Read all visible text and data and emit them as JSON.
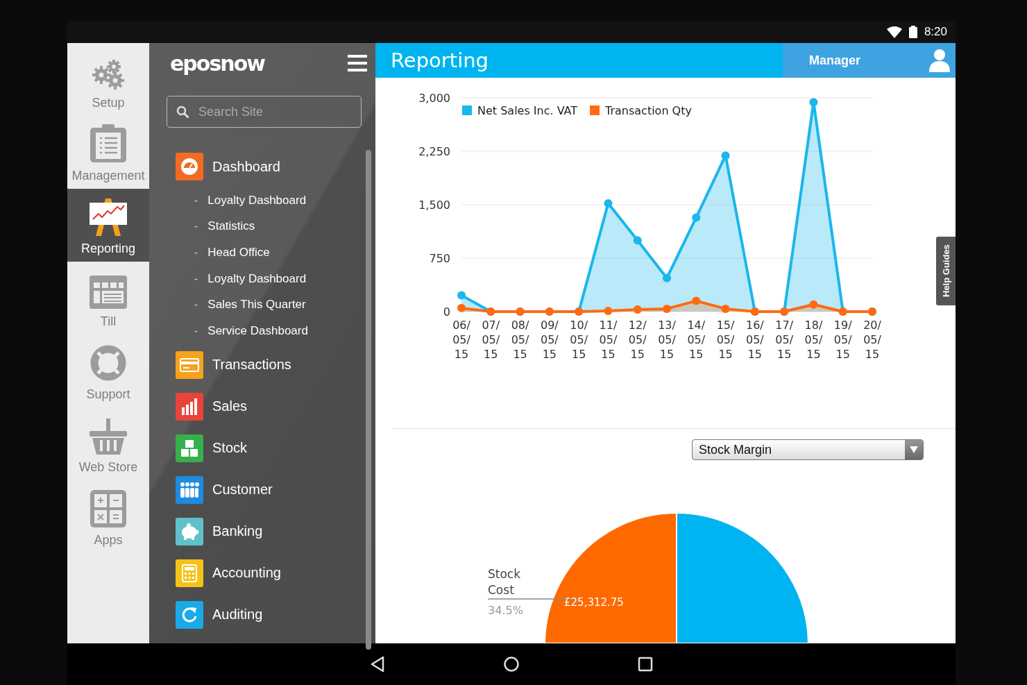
{
  "status_bar": {
    "time": "8:20"
  },
  "rail": {
    "items": [
      {
        "label": "Setup",
        "selected": false
      },
      {
        "label": "Management",
        "selected": false
      },
      {
        "label": "Reporting",
        "selected": true
      },
      {
        "label": "Till",
        "selected": false
      },
      {
        "label": "Support",
        "selected": false
      },
      {
        "label": "Web Store",
        "selected": false
      },
      {
        "label": "Apps",
        "selected": false
      }
    ]
  },
  "menu": {
    "logo": "eposnow",
    "search": {
      "placeholder": "Search Site"
    },
    "items": [
      {
        "label": "Dashboard",
        "color": "#f26b21",
        "children": [
          {
            "marker": "-",
            "label": "Loyalty Dashboard"
          },
          {
            "marker": "-",
            "label": "Statistics"
          },
          {
            "marker": "-",
            "label": "Head Office"
          },
          {
            "marker": "-",
            "label": "Loyalty Dashboard"
          },
          {
            "marker": "-",
            "label": "Sales This Quarter"
          },
          {
            "marker": "-",
            "label": "Service Dashboard"
          }
        ]
      },
      {
        "label": "Transactions",
        "color": "#f6a21d"
      },
      {
        "label": "Sales",
        "color": "#e8443a"
      },
      {
        "label": "Stock",
        "color": "#35b04a"
      },
      {
        "label": "Customer",
        "color": "#1e8be0"
      },
      {
        "label": "Banking",
        "color": "#5fc1c9"
      },
      {
        "label": "Accounting",
        "color": "#f5c316"
      },
      {
        "label": "Auditing",
        "color": "#1aaae8"
      }
    ]
  },
  "header": {
    "title": "Reporting",
    "user": "Manager"
  },
  "sales_chart": {
    "chart_data": {
      "type": "area",
      "categories": [
        "06/05/15",
        "07/05/15",
        "08/05/15",
        "09/05/15",
        "10/05/15",
        "11/05/15",
        "12/05/15",
        "13/05/15",
        "14/05/15",
        "15/05/15",
        "16/05/15",
        "17/05/15",
        "18/05/15",
        "19/05/15",
        "20/05/15"
      ],
      "series": [
        {
          "name": "Net Sales Inc. VAT",
          "color": "#1ab6ec",
          "values": [
            230,
            0,
            0,
            0,
            0,
            1520,
            1000,
            470,
            1320,
            2190,
            0,
            0,
            2940,
            0,
            0
          ]
        },
        {
          "name": "Transaction Qty",
          "color": "#ff6a13",
          "values": [
            50,
            0,
            0,
            0,
            0,
            10,
            30,
            40,
            150,
            40,
            0,
            0,
            100,
            0,
            0
          ]
        }
      ],
      "grid": true,
      "legend": "top-left",
      "ylim": [
        0,
        3000
      ],
      "yticks": [
        {
          "value": 0,
          "label": "0"
        },
        {
          "value": 750,
          "label": "750"
        },
        {
          "value": 1500,
          "label": "1,500"
        },
        {
          "value": 2250,
          "label": "2,250"
        },
        {
          "value": 3000,
          "label": "3,000"
        }
      ]
    }
  },
  "help_tab": {
    "label": "Help Guides"
  },
  "stock_panel": {
    "dropdown": {
      "value": "Stock Margin"
    },
    "slices": [
      {
        "label": "Stock Cost",
        "amount": "£25,312.75",
        "share": "34.5%",
        "color": "#ff6a00"
      },
      {
        "color": "#00b4f2"
      }
    ]
  }
}
